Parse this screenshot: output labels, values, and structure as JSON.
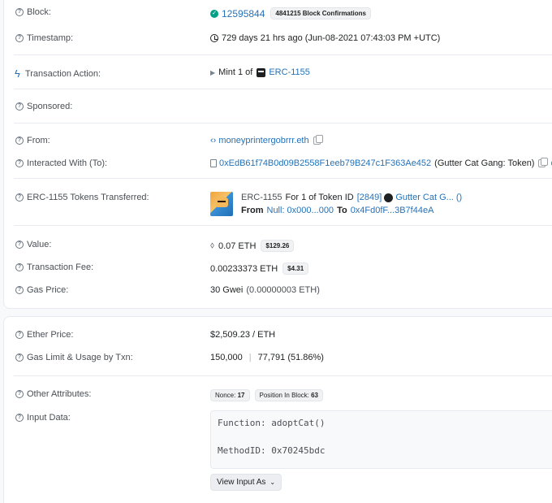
{
  "block": {
    "label": "Block:",
    "number": "12595844",
    "confirmations": "4841215 Block Confirmations"
  },
  "timestamp": {
    "label": "Timestamp:",
    "value": "729 days 21 hrs ago (Jun-08-2021 07:43:03 PM +UTC)"
  },
  "action": {
    "label": "Transaction Action:",
    "text": "Mint 1 of",
    "token": "ERC-1155"
  },
  "sponsored": {
    "label": "Sponsored:"
  },
  "from": {
    "label": "From:",
    "value": "moneyprintergobrrr.eth"
  },
  "interacted": {
    "label": "Interacted With (To):",
    "address": "0xEdB61f74B0d09B2558F1eeb79B247c1F363Ae452",
    "name": "(Gutter Cat Gang: Token)"
  },
  "transfer": {
    "label": "ERC-1155 Tokens Transferred:",
    "standard": "ERC-1155",
    "for_text": "For 1 of Token ID",
    "token_id": "[2849]",
    "token_name": "Gutter Cat G... ()",
    "from_label": "From",
    "from_addr": "Null: 0x000...000",
    "to_label": "To",
    "to_addr": "0x4Fd0fF...3B7f44eA"
  },
  "value": {
    "label": "Value:",
    "amount": "0.07 ETH",
    "usd": "$129.26"
  },
  "fee": {
    "label": "Transaction Fee:",
    "amount": "0.00233373 ETH",
    "usd": "$4.31"
  },
  "gas_price": {
    "label": "Gas Price:",
    "value": "30 Gwei",
    "eth": "(0.00000003 ETH)"
  },
  "ether_price": {
    "label": "Ether Price:",
    "value": "$2,509.23 / ETH"
  },
  "gas_limit": {
    "label": "Gas Limit & Usage by Txn:",
    "limit": "150,000",
    "usage": "77,791 (51.86%)"
  },
  "other": {
    "label": "Other Attributes:",
    "nonce_label": "Nonce:",
    "nonce": "17",
    "position_label": "Position In Block:",
    "position": "63"
  },
  "input": {
    "label": "Input Data:",
    "function": "Function: adoptCat()",
    "method": "MethodID: 0x70245bdc",
    "button": "View Input As"
  },
  "colors": {
    "link": "#2472b8",
    "success": "#00a186",
    "text": "#1e2022"
  }
}
